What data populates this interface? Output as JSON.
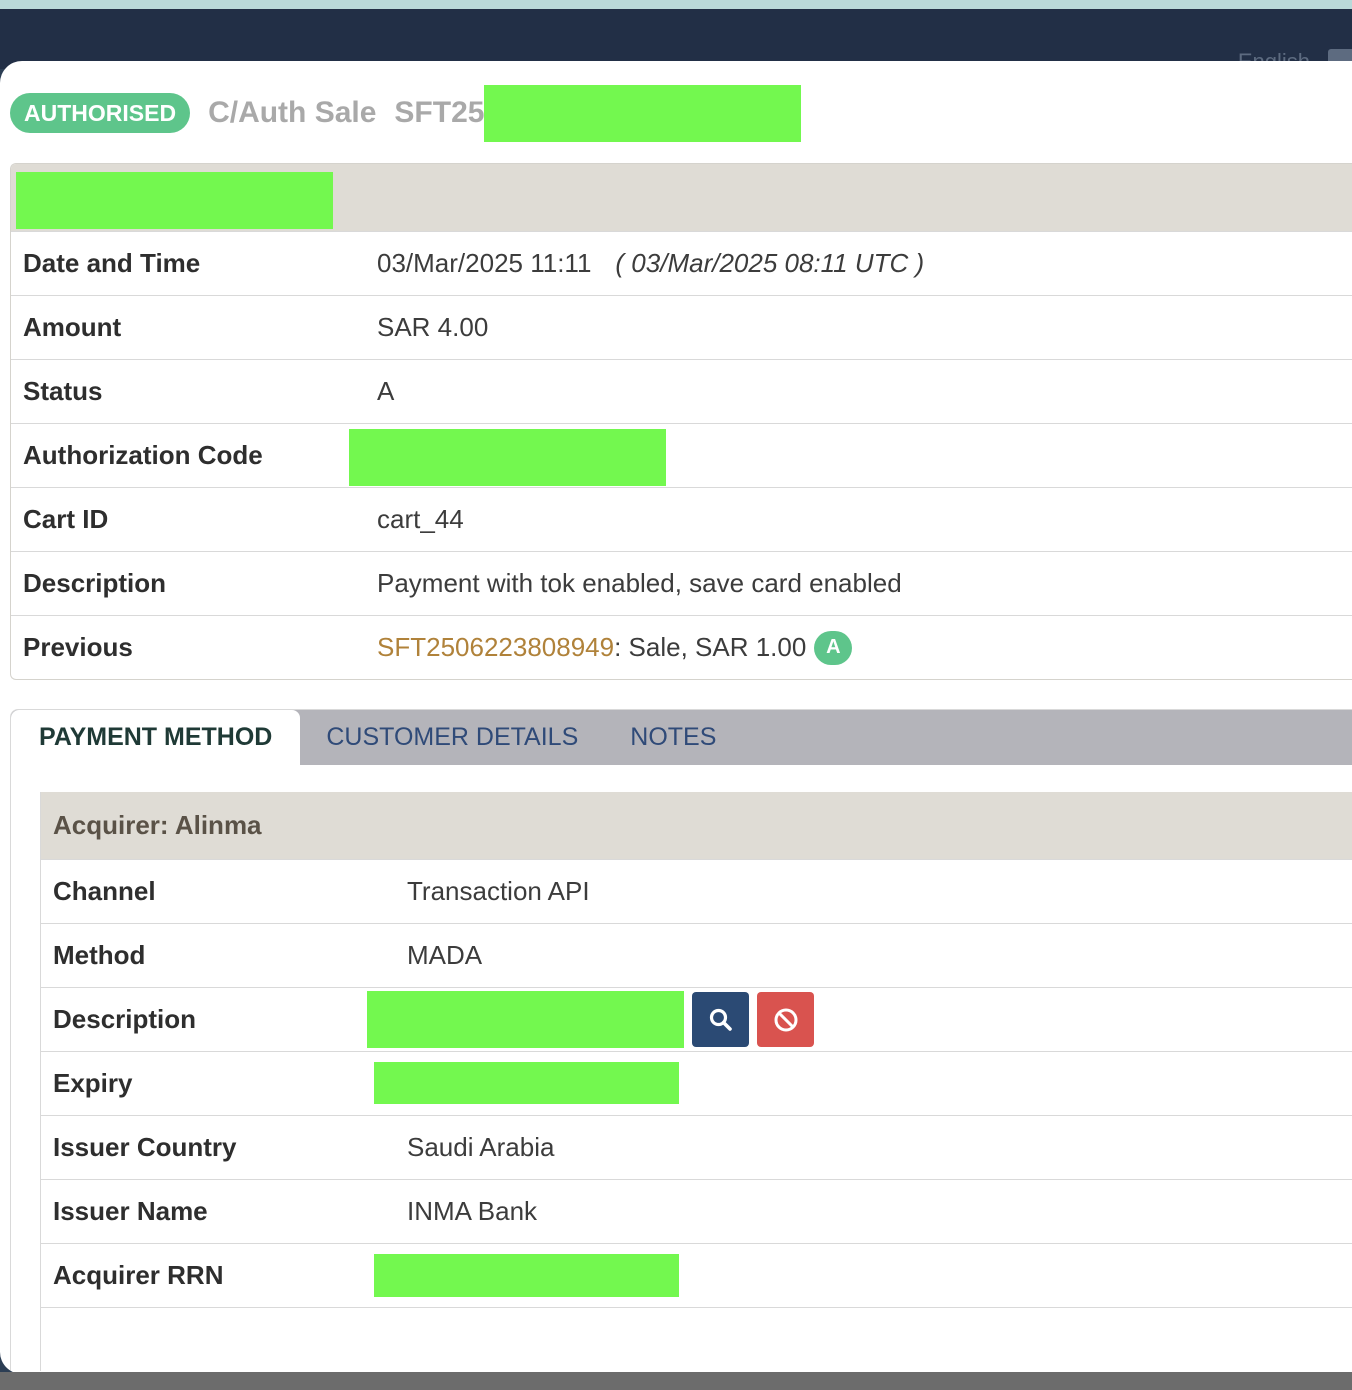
{
  "navbar": {
    "language": "English"
  },
  "transaction": {
    "status_badge": "AUTHORISED",
    "type": "C/Auth Sale",
    "reference_prefix": "SFT25"
  },
  "details": [
    {
      "label": "Date and Time",
      "value": "03/Mar/2025 11:11",
      "utc": "( 03/Mar/2025 08:11 UTC )"
    },
    {
      "label": "Amount",
      "value": "SAR 4.00"
    },
    {
      "label": "Status",
      "value": "A"
    },
    {
      "label": "Authorization Code",
      "value": ""
    },
    {
      "label": "Cart ID",
      "value": "cart_44"
    },
    {
      "label": "Description",
      "value": "Payment with tok enabled, save card enabled"
    },
    {
      "label": "Previous",
      "link": "SFT2506223808949",
      "value": ": Sale, SAR 1.00",
      "badge": "A"
    }
  ],
  "tabs": [
    {
      "label": "PAYMENT METHOD",
      "active": true
    },
    {
      "label": "CUSTOMER DETAILS",
      "active": false
    },
    {
      "label": "NOTES",
      "active": false
    }
  ],
  "payment": {
    "acquirer_heading": "Acquirer: Alinma",
    "rows": [
      {
        "label": "Channel",
        "value": "Transaction API"
      },
      {
        "label": "Method",
        "value": "MADA"
      },
      {
        "label": "Description",
        "value": ""
      },
      {
        "label": "Expiry",
        "value": ""
      },
      {
        "label": "Issuer Country",
        "value": "Saudi Arabia"
      },
      {
        "label": "Issuer Name",
        "value": "INMA Bank"
      },
      {
        "label": "Acquirer RRN",
        "value": ""
      }
    ]
  },
  "colors": {
    "badge_green": "#5ec58b",
    "link_gold": "#b0823a",
    "search_button": "#2b4a74",
    "block_button": "#d9534f",
    "redaction": "#73f84f"
  },
  "icons": [
    "search-icon",
    "block-icon"
  ]
}
